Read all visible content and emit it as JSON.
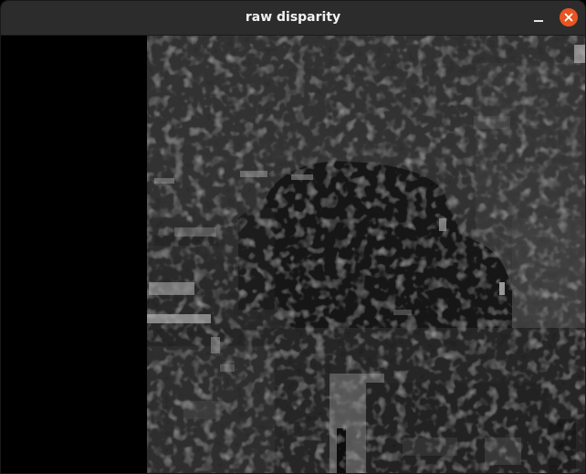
{
  "window": {
    "title": "raw disparity"
  },
  "titlebar": {
    "minimize_icon": "minimize-icon",
    "close_icon": "close-icon",
    "close_color": "#e95420"
  },
  "image": {
    "description_kind": "grayscale disparity map"
  }
}
